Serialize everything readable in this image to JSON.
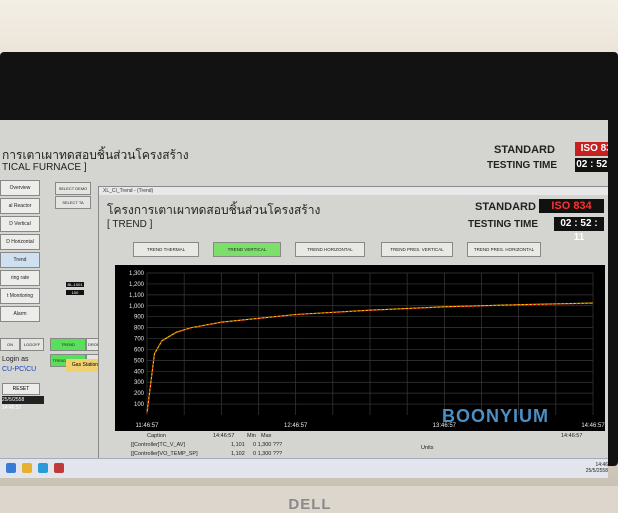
{
  "bg_app": {
    "title": "การเตาเผาทดสอบชิ้นส่วนโครงสร้าง",
    "subtitle": "TICAL FURNACE ]",
    "standard_label": "STANDARD",
    "iso": "ISO 834",
    "testing_label": "TESTING TIME",
    "time": "02 : 52 : 1",
    "sidebar": [
      "Overview",
      "al Reactor",
      "D Vertical",
      "D Horizontal",
      "Trend",
      "ring rate",
      "t Monitoring",
      "Alarm"
    ],
    "select_buttons": [
      "SELECT DEMO",
      "SELECT TA"
    ],
    "trend_buttons": [
      "TREND VERTICAL",
      "DROP VERTICAL",
      "TREND SLIDING",
      "DROP SLIDING"
    ],
    "bl_label": "BL-1001",
    "bl_value": "100",
    "small_value": "31.8",
    "login_buttons": [
      "ON",
      "LOGOFF"
    ],
    "login_label": "Login as",
    "user": "CU-PC\\CU",
    "reset": "RESET",
    "date": "25/5/2558 14:46:57",
    "gas": "Gas Station"
  },
  "window": {
    "bar": "XL_CI_Trend - (Trend)",
    "title": "โครงการเตาเผาทดสอบชิ้นส่วนโครงสร้าง",
    "subtitle": "[ TREND ]",
    "standard_label": "STANDARD",
    "iso": "ISO 834",
    "testing_label": "TESTING TIME",
    "time": "02 : 52 : 11",
    "tabs": [
      "TREND THERMAL",
      "TREND VERTICAL",
      "TREND HORIZONTAL",
      "TREND PRES. VERTICAL",
      "TREND PRES. HORIZONTAL"
    ],
    "active_tab": 1
  },
  "chart_data": {
    "type": "line",
    "ylim": [
      0,
      1300
    ],
    "yticks": [
      "1,300",
      "1,200",
      "1,100",
      "1,000",
      "900",
      "800",
      "700",
      "600",
      "500",
      "400",
      "300",
      "200",
      "100"
    ],
    "xlabels": [
      "11:46:57",
      "12:46:57",
      "13:46:57",
      "14:46:57"
    ],
    "series": [
      {
        "color": "#ffd400",
        "x": [
          0,
          0.05,
          0.1,
          0.2,
          0.3,
          0.5,
          1,
          1.5,
          2,
          2.5,
          3
        ],
        "y": [
          20,
          560,
          680,
          760,
          800,
          850,
          920,
          960,
          990,
          1010,
          1025
        ]
      },
      {
        "color": "#e02020",
        "x": [
          0,
          0.05,
          0.1,
          0.2,
          0.3,
          0.5,
          1,
          1.5,
          2,
          2.5,
          3
        ],
        "y": [
          20,
          555,
          675,
          755,
          798,
          848,
          918,
          958,
          988,
          1008,
          1022
        ]
      }
    ],
    "legend_header": {
      "caption": "Caption",
      "start": "14:46:57",
      "min": "Min",
      "max": "Max"
    },
    "legend_rows": [
      {
        "caption": "[[Controller]TC_V_AV]",
        "value": "1,101",
        "range": "0  1,300 ???"
      },
      {
        "caption": "[[Controller]VO_TEMP_SP]",
        "value": "1,102",
        "range": "0  1,300 ???"
      }
    ],
    "x_end": "14:46:57",
    "units": "Units"
  },
  "taskbar": {
    "clock": "14:46\n25/5/2558"
  },
  "monitor_brand": "DELL",
  "watermark": "BOONYIUM"
}
